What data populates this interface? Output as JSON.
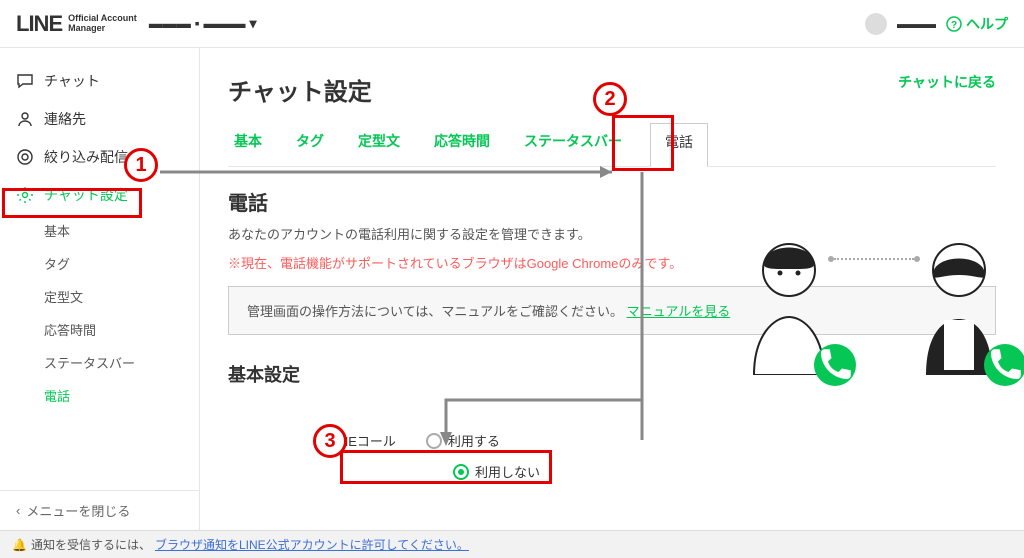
{
  "brand": {
    "logo": "LINE",
    "sub1": "Official Account",
    "sub2": "Manager"
  },
  "account_name": "▬▬▬ ▪ ▬▬▬ ▾",
  "topbar": {
    "user": "▬▬▬",
    "help": "ヘルプ"
  },
  "sidebar": {
    "items": [
      {
        "label": "チャット",
        "icon": "chat"
      },
      {
        "label": "連絡先",
        "icon": "contacts"
      },
      {
        "label": "絞り込み配信",
        "icon": "target"
      },
      {
        "label": "チャット設定",
        "icon": "gear",
        "active": true
      }
    ],
    "subs": [
      {
        "label": "基本"
      },
      {
        "label": "タグ"
      },
      {
        "label": "定型文"
      },
      {
        "label": "応答時間"
      },
      {
        "label": "ステータスバー"
      },
      {
        "label": "電話",
        "active": true
      }
    ],
    "close": "メニューを閉じる"
  },
  "main": {
    "title": "チャット設定",
    "back": "チャットに戻る",
    "tabs": [
      {
        "label": "基本"
      },
      {
        "label": "タグ"
      },
      {
        "label": "定型文"
      },
      {
        "label": "応答時間"
      },
      {
        "label": "ステータスバー"
      },
      {
        "label": "電話",
        "selected": true
      }
    ],
    "section": "電話",
    "desc": "あなたのアカウントの電話利用に関する設定を管理できます。",
    "warn": "※現在、電話機能がサポートされているブラウザはGoogle Chromeのみです。",
    "infobox_pre": "管理画面の操作方法については、マニュアルをご確認ください。",
    "infobox_link": "マニュアルを見る",
    "basic_heading": "基本設定",
    "line_call_label": "LINEコール",
    "opts": [
      {
        "label": "利用する",
        "on": false
      },
      {
        "label": "利用しない",
        "on": true
      }
    ]
  },
  "footer": {
    "pre": "通知を受信するには、",
    "link": "ブラウザ通知をLINE公式アカウントに許可してください。"
  },
  "annotations": {
    "n1": "1",
    "n2": "2",
    "n3": "3"
  }
}
